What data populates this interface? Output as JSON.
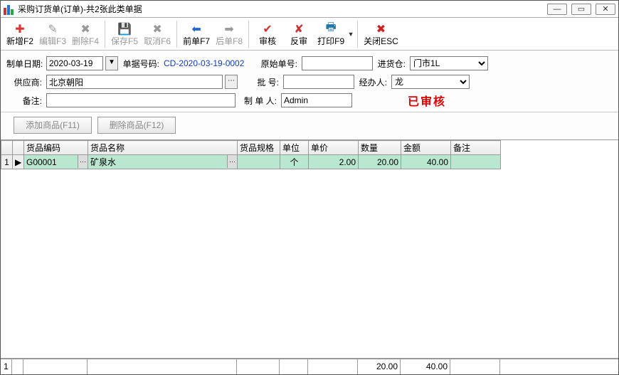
{
  "window": {
    "title": "采购订货单(订单)-共2张此类单据"
  },
  "toolbar": {
    "new": "新增F2",
    "edit": "编辑F3",
    "delete": "删除F4",
    "save": "保存F5",
    "cancel": "取消F6",
    "prev": "前单F7",
    "next": "后单F8",
    "audit": "审核",
    "unaudit": "反审",
    "print": "打印F9",
    "close": "关闭ESC"
  },
  "form": {
    "date_label": "制单日期:",
    "date_value": "2020-03-19",
    "code_label": "单据号码:",
    "code_value": "CD-2020-03-19-0002",
    "orig_label": "原始单号:",
    "orig_value": "",
    "warehouse_label": "进货仓:",
    "warehouse_value": "门市1L",
    "supplier_label": "供应商:",
    "supplier_value": "北京朝阳",
    "batch_label": "批    号:",
    "batch_value": "",
    "agent_label": "经办人:",
    "agent_value": "龙",
    "remark_label": "备注:",
    "remark_value": "",
    "maker_label": "制 单 人:",
    "maker_value": "Admin",
    "status": "已审核"
  },
  "actions": {
    "add_item": "添加商品(F11)",
    "del_item": "删除商品(F12)"
  },
  "grid": {
    "headers": {
      "code": "货品编码",
      "name": "货品名称",
      "spec": "货品规格",
      "unit": "单位",
      "price": "单价",
      "qty": "数量",
      "amount": "金额",
      "remark": "备注"
    },
    "rows": [
      {
        "idx": "1",
        "marker": "▶",
        "code": "G00001",
        "name": "矿泉水",
        "spec": "",
        "unit": "个",
        "price": "2.00",
        "qty": "20.00",
        "amount": "40.00",
        "remark": ""
      }
    ],
    "footer": {
      "idx": "1",
      "qty": "20.00",
      "amount": "40.00"
    }
  }
}
